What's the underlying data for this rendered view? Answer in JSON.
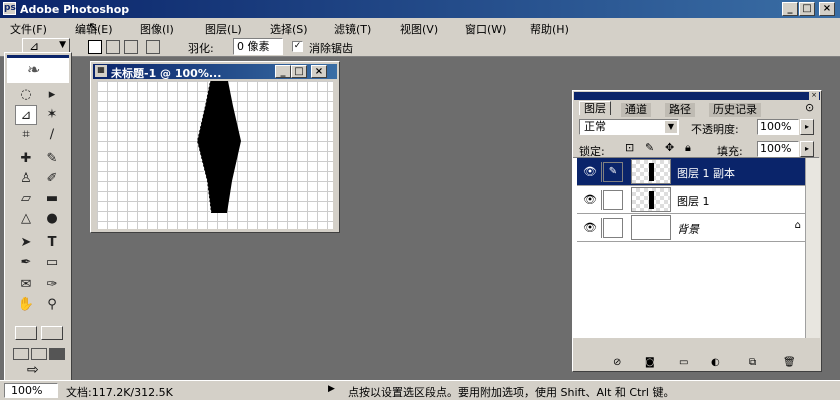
{
  "app": {
    "title": "Adobe Photoshop"
  },
  "menu": [
    "文件(F)",
    "编辑(E)",
    "图像(I)",
    "图层(L)",
    "选择(S)",
    "滤镜(T)",
    "视图(V)",
    "窗口(W)",
    "帮助(H)"
  ],
  "options": {
    "feather_label": "羽化:",
    "feather_value": "0 像素",
    "antialias_label": "消除锯齿",
    "antialias_checked": true
  },
  "document": {
    "title": "未标题-1 @ 100%..."
  },
  "layers_panel": {
    "tabs": [
      "图层",
      "通道",
      "路径",
      "历史记录"
    ],
    "blend_mode": "正常",
    "opacity_label": "不透明度:",
    "opacity_value": "100%",
    "lock_label": "锁定:",
    "fill_label": "填充:",
    "fill_value": "100%",
    "layers": [
      {
        "name": "图层 1 副本",
        "selected": true
      },
      {
        "name": "图层 1",
        "selected": false
      },
      {
        "name": "背景",
        "selected": false,
        "locked": true
      }
    ]
  },
  "status": {
    "zoom": "100%",
    "doc_info": "文档:117.2K/312.5K",
    "hint": "点按以设置选区段点。要用附加选项，使用 Shift、Alt 和 Ctrl 键。"
  },
  "colors": {
    "titlebar": "#0a246a",
    "chrome": "#d4d0c8",
    "workspace": "#6d6d6d",
    "foreground": "#000000",
    "background": "#ffffff"
  }
}
